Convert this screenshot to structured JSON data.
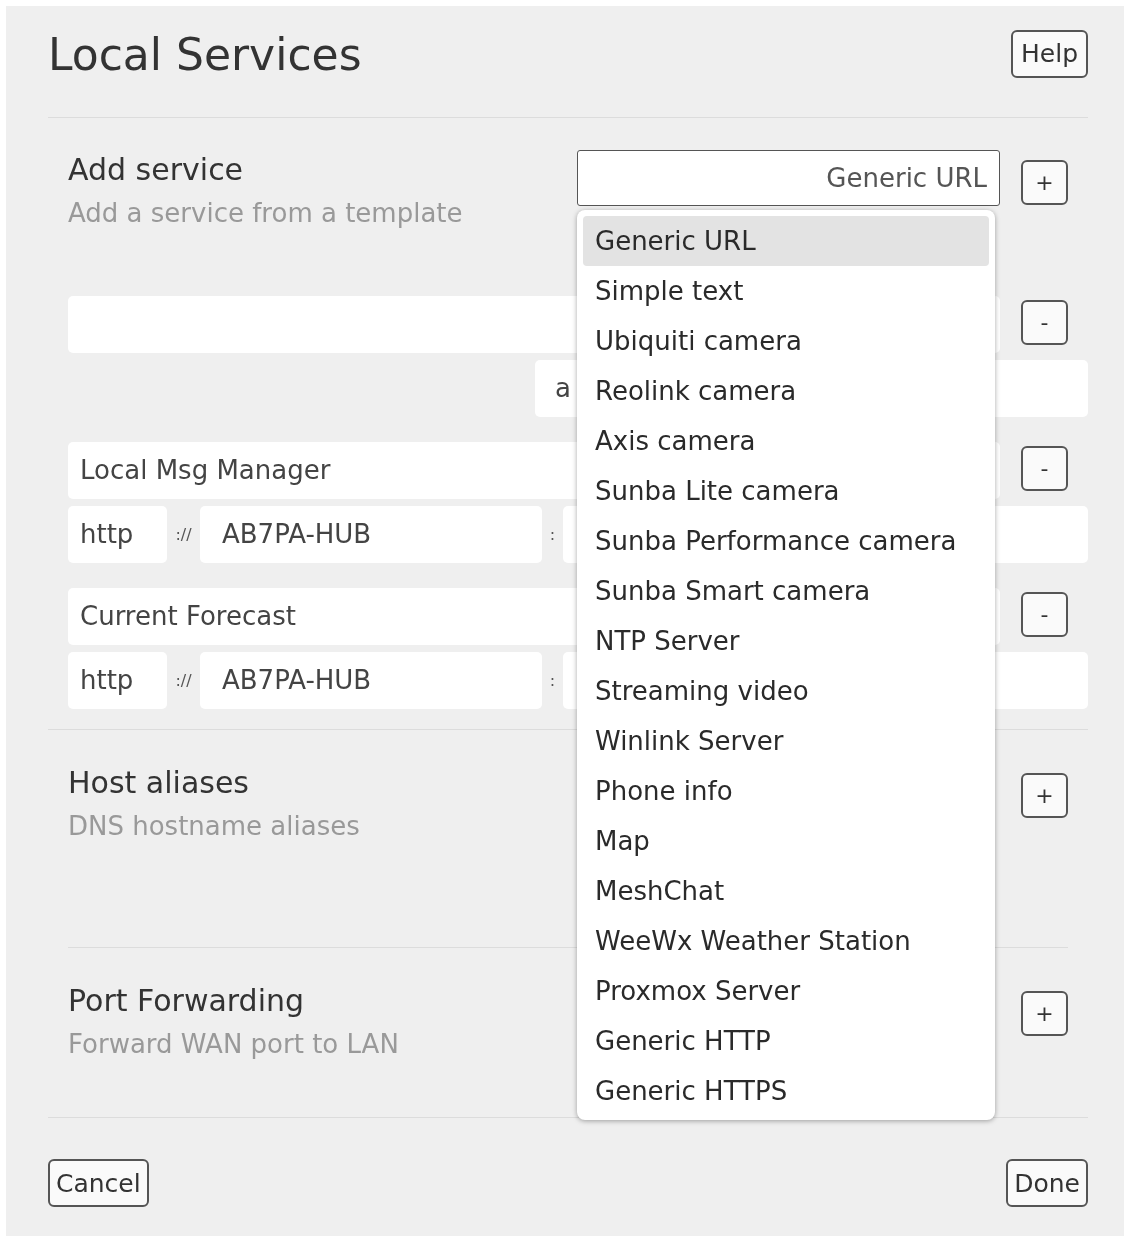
{
  "title": "Local Services",
  "help_button": "Help",
  "add_service": {
    "heading": "Add service",
    "subtitle": "Add a service from a template",
    "add_button": "+",
    "template_select": {
      "value": "Generic URL",
      "expanded": true,
      "options": [
        {
          "label": "Generic URL",
          "selected": true
        },
        {
          "label": "Simple text",
          "selected": false
        },
        {
          "label": "Ubiquiti camera",
          "selected": false
        },
        {
          "label": "Reolink camera",
          "selected": false
        },
        {
          "label": "Axis camera",
          "selected": false
        },
        {
          "label": "Sunba Lite camera",
          "selected": false
        },
        {
          "label": "Sunba Performance camera",
          "selected": false
        },
        {
          "label": "Sunba Smart camera",
          "selected": false
        },
        {
          "label": "NTP Server",
          "selected": false
        },
        {
          "label": "Streaming video",
          "selected": false
        },
        {
          "label": "Winlink Server",
          "selected": false
        },
        {
          "label": "Phone info",
          "selected": false
        },
        {
          "label": "Map",
          "selected": false
        },
        {
          "label": "MeshChat",
          "selected": false
        },
        {
          "label": "WeeWx Weather Station",
          "selected": false
        },
        {
          "label": "Proxmox Server",
          "selected": false
        },
        {
          "label": "Generic HTTP",
          "selected": false
        },
        {
          "label": "Generic HTTPS",
          "selected": false
        }
      ]
    }
  },
  "services": [
    {
      "kind": "text",
      "value": "a",
      "remove_button": "-"
    },
    {
      "kind": "url",
      "name": "Local Msg Manager",
      "scheme": "http",
      "separator": "://",
      "host": "AB7PA-HUB",
      "port_separator": ":",
      "remove_button": "-"
    },
    {
      "kind": "url",
      "name": "Current Forecast",
      "scheme": "http",
      "separator": "://",
      "host": "AB7PA-HUB",
      "port_separator": ":",
      "remove_button": "-"
    }
  ],
  "sections": [
    {
      "heading": "Host aliases",
      "subtitle": "DNS hostname aliases",
      "add_button": "+"
    },
    {
      "heading": "Port Forwarding",
      "subtitle": "Forward WAN port to LAN",
      "add_button": "+"
    }
  ],
  "cancel_button": "Cancel",
  "done_button": "Done"
}
